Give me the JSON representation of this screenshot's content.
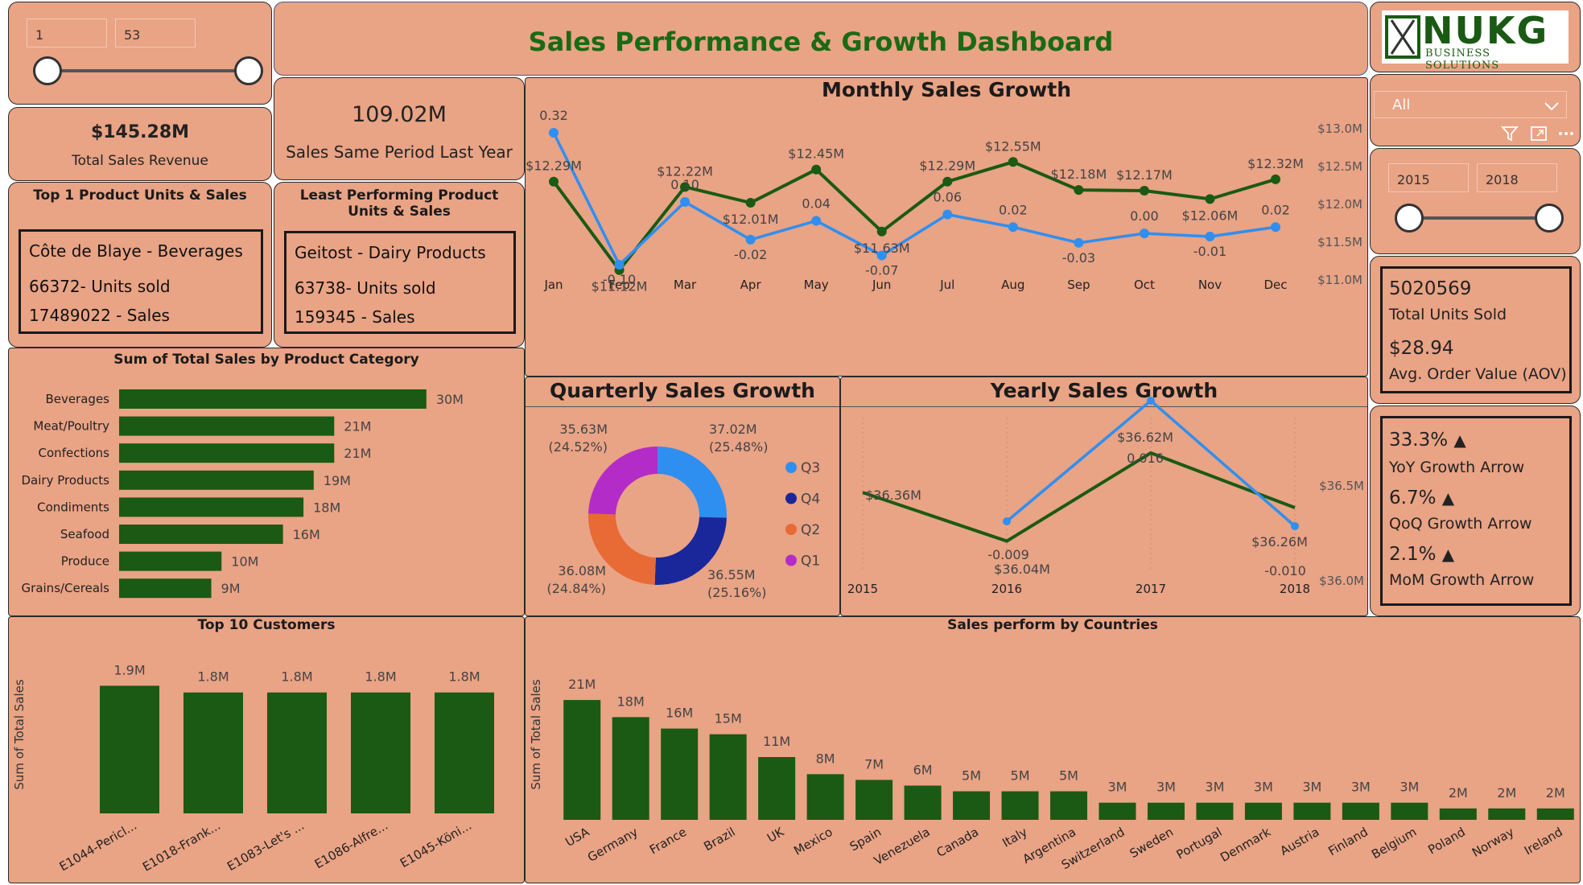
{
  "header": {
    "title": "Sales Performance & Growth Dashboard",
    "logo_main": "NUKG",
    "logo_sub": "BUSINESS SOLUTIONS"
  },
  "range_slicer": {
    "min": "1",
    "max": "53"
  },
  "year_slicer": {
    "from": "2015",
    "to": "2018"
  },
  "dropdown": {
    "value": "All"
  },
  "kpi": {
    "total_sales_value": "$145.28M",
    "total_sales_label": "Total Sales Revenue",
    "same_period_value": "109.02M",
    "same_period_label": "Sales Same Period Last Year",
    "units_value": "5020569",
    "units_label": "Total Units Sold",
    "aov_value": "$28.94",
    "aov_label": "Avg. Order Value (AOV)"
  },
  "top_product": {
    "title": "Top 1 Product Units & Sales",
    "name": "Côte de Blaye - Beverages",
    "units": "66372- Units sold",
    "sales": "17489022 - Sales"
  },
  "least_product": {
    "title": "Least Performing Product Units & Sales",
    "name": "Geitost - Dairy Products",
    "units": "63738- Units sold",
    "sales": "159345 - Sales"
  },
  "growth": {
    "yoy_value": "33.3%",
    "yoy_label": "YoY Growth Arrow",
    "qoq_value": "6.7%",
    "qoq_label": "QoQ Growth Arrow",
    "mom_value": "2.1%",
    "mom_label": "MoM Growth Arrow",
    "arrow": "▲"
  },
  "chart_data": [
    {
      "id": "monthly",
      "type": "line",
      "title": "Monthly Sales Growth",
      "categories": [
        "Jan",
        "Feb",
        "Mar",
        "Apr",
        "May",
        "Jun",
        "Jul",
        "Aug",
        "Sep",
        "Oct",
        "Nov",
        "Dec"
      ],
      "series": [
        {
          "values": [
            12.29,
            11.12,
            12.22,
            12.01,
            12.45,
            11.63,
            12.29,
            12.55,
            12.18,
            12.17,
            12.06,
            12.32
          ],
          "labels": [
            "$12.29M",
            "$11.12M",
            "$12.22M",
            "$12.01M",
            "$12.45M",
            "$11.63M",
            "$12.29M",
            "$12.55M",
            "$12.18M",
            "$12.17M",
            "$12.06M",
            "$12.32M"
          ],
          "color": "#1a5a14"
        },
        {
          "values": [
            0.32,
            -0.1,
            0.1,
            -0.02,
            0.04,
            -0.07,
            0.06,
            0.02,
            -0.03,
            0.0,
            -0.01,
            0.02
          ],
          "labels": [
            "0.32",
            "-0.10",
            "0.10",
            "-0.02",
            "0.04",
            "-0.07",
            "0.06",
            "0.02",
            "-0.03",
            "0.00",
            "-0.01",
            "0.02"
          ],
          "color": "#2f8ff0"
        }
      ],
      "y_ticks": [
        "$13.0M",
        "$12.5M",
        "$12.0M",
        "$11.5M",
        "$11.0M"
      ],
      "ylim": [
        11.0,
        13.0
      ]
    },
    {
      "id": "quarterly",
      "type": "pie",
      "title": "Quarterly Sales Growth",
      "slices": [
        {
          "name": "Q3",
          "value": 37.02,
          "label": "37.02M",
          "pct": "(25.48%)",
          "color": "#2f8ff0"
        },
        {
          "name": "Q4",
          "value": 36.55,
          "label": "36.55M",
          "pct": "(25.16%)",
          "color": "#1a279a"
        },
        {
          "name": "Q2",
          "value": 36.08,
          "label": "36.08M",
          "pct": "(24.84%)",
          "color": "#e86a35"
        },
        {
          "name": "Q1",
          "value": 35.63,
          "label": "35.63M",
          "pct": "(24.52%)",
          "color": "#b42cc8"
        }
      ]
    },
    {
      "id": "yearly",
      "type": "line",
      "title": "Yearly Sales Growth",
      "categories": [
        "2015",
        "2016",
        "2017",
        "2018"
      ],
      "series": [
        {
          "values": [
            36.36,
            36.04,
            36.62,
            36.26
          ],
          "labels": [
            "$36.36M",
            "$36.04M",
            "$36.62M",
            "$36.26M"
          ],
          "color": "#1a5a14"
        },
        {
          "values": [
            null,
            -0.009,
            0.016,
            -0.01
          ],
          "labels": [
            "",
            "-0.009",
            "0.016",
            "-0.010"
          ],
          "color": "#2f8ff0"
        }
      ],
      "y_ticks": [
        "$36.5M",
        "$36.0M"
      ],
      "ylim": [
        35.9,
        36.8
      ]
    },
    {
      "id": "category",
      "type": "bar",
      "title": "Sum of Total Sales by Product Category",
      "categories": [
        "Beverages",
        "Meat/Poultry",
        "Confections",
        "Dairy Products",
        "Condiments",
        "Seafood",
        "Produce",
        "Grains/Cereals"
      ],
      "values": [
        30,
        21,
        21,
        19,
        18,
        16,
        10,
        9
      ],
      "labels": [
        "30M",
        "21M",
        "21M",
        "19M",
        "18M",
        "16M",
        "10M",
        "9M"
      ],
      "xlim": [
        0,
        33
      ]
    },
    {
      "id": "customers",
      "type": "bar",
      "title": "Top 10 Customers",
      "ylabel": "Sum of Total Sales",
      "categories": [
        "E1044-Pericl...",
        "E1018-Frank...",
        "E1083-Let's ...",
        "E1086-Alfre...",
        "E1045-Köni..."
      ],
      "values": [
        1.9,
        1.8,
        1.8,
        1.8,
        1.8
      ],
      "labels": [
        "1.9M",
        "1.8M",
        "1.8M",
        "1.8M",
        "1.8M"
      ],
      "ylim": [
        0,
        2.0
      ]
    },
    {
      "id": "countries",
      "type": "bar",
      "title": "Sales perform by Countries",
      "ylabel": "Sum of Total Sales",
      "categories": [
        "USA",
        "Germany",
        "France",
        "Brazil",
        "UK",
        "Mexico",
        "Spain",
        "Venezuela",
        "Canada",
        "Italy",
        "Argentina",
        "Switzerland",
        "Sweden",
        "Portugal",
        "Denmark",
        "Austria",
        "Finland",
        "Belgium",
        "Poland",
        "Norway",
        "Ireland"
      ],
      "values": [
        21,
        18,
        16,
        15,
        11,
        8,
        7,
        6,
        5,
        5,
        5,
        3,
        3,
        3,
        3,
        3,
        3,
        3,
        2,
        2,
        2
      ],
      "labels": [
        "21M",
        "18M",
        "16M",
        "15M",
        "11M",
        "8M",
        "7M",
        "6M",
        "5M",
        "5M",
        "5M",
        "3M",
        "3M",
        "3M",
        "3M",
        "3M",
        "3M",
        "3M",
        "2M",
        "2M",
        "2M"
      ],
      "ylim": [
        0,
        22
      ]
    }
  ],
  "colors": {
    "card_bg": "#e9a385",
    "dark_green": "#1a5a14",
    "title_green": "#1a6a14",
    "blue": "#2f8ff0"
  },
  "icons": {
    "filter": "filter-icon",
    "focus": "focus-mode-icon",
    "more": "more-options-icon",
    "dropdown": "chevron-down-icon"
  }
}
